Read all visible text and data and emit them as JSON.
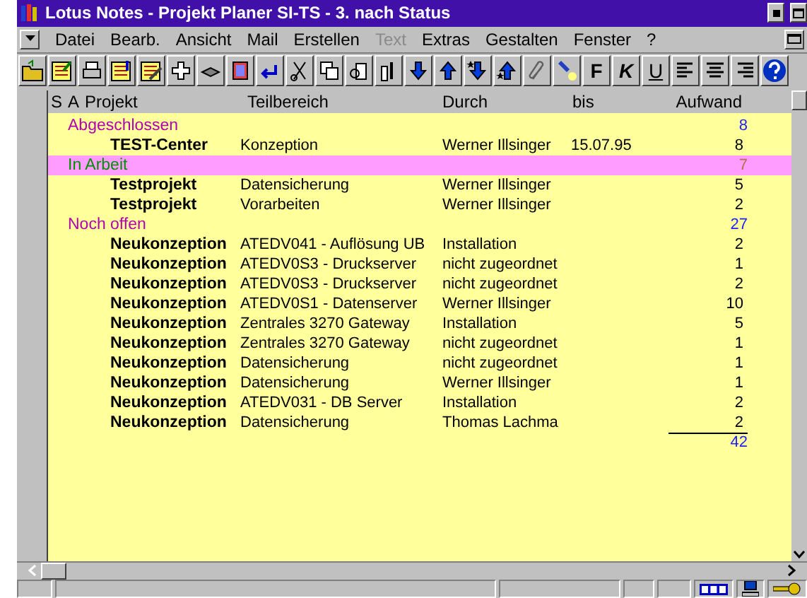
{
  "window": {
    "title": "Lotus Notes - Projekt Planer SI-TS - 3. nach Status"
  },
  "menu": [
    {
      "label": "Datei",
      "disabled": false
    },
    {
      "label": "Bearb.",
      "disabled": false
    },
    {
      "label": "Ansicht",
      "disabled": false
    },
    {
      "label": "Mail",
      "disabled": false
    },
    {
      "label": "Erstellen",
      "disabled": false
    },
    {
      "label": "Text",
      "disabled": true
    },
    {
      "label": "Extras",
      "disabled": false
    },
    {
      "label": "Gestalten",
      "disabled": false
    },
    {
      "label": "Fenster",
      "disabled": false
    },
    {
      "label": "?",
      "disabled": false
    }
  ],
  "format_buttons": [
    {
      "label": "F",
      "kind": "bold"
    },
    {
      "label": "K",
      "kind": "italic"
    },
    {
      "label": "U",
      "kind": "underline"
    }
  ],
  "columns": [
    "S",
    "A",
    "Projekt",
    "Teilbereich",
    "Durch",
    "bis",
    "Aufwand"
  ],
  "rows": [
    {
      "kind": "category",
      "label": "Abgeschlossen",
      "color": "#b000b0",
      "count": "8",
      "highlighted": false
    },
    {
      "kind": "item",
      "projekt": "TEST-Center",
      "teilbereich": "Konzeption",
      "durch": "Werner Illsinger",
      "bis": "15.07.95",
      "aufwand": "8"
    },
    {
      "kind": "category",
      "label": "In Arbeit",
      "color": "#008f00",
      "count": "7",
      "highlighted": true
    },
    {
      "kind": "item",
      "projekt": "Testprojekt",
      "teilbereich": "Datensicherung",
      "durch": "Werner Illsinger",
      "aufwand": "5"
    },
    {
      "kind": "item",
      "projekt": "Testprojekt",
      "teilbereich": "Vorarbeiten",
      "durch": "Werner Illsinger",
      "aufwand": "2"
    },
    {
      "kind": "category",
      "label": "Noch offen",
      "color": "#b000b0",
      "count": "27",
      "highlighted": false
    },
    {
      "kind": "item",
      "projekt": "Neukonzeption",
      "teilbereich": "ATEDV041 - Auflösung UB",
      "durch": "Installation",
      "aufwand": "2"
    },
    {
      "kind": "item",
      "projekt": "Neukonzeption",
      "teilbereich": "ATEDV0S3 - Druckserver",
      "durch": "nicht zugeordnet",
      "aufwand": "1"
    },
    {
      "kind": "item",
      "projekt": "Neukonzeption",
      "teilbereich": "ATEDV0S3 - Druckserver",
      "durch": "nicht zugeordnet",
      "aufwand": "2"
    },
    {
      "kind": "item",
      "projekt": "Neukonzeption",
      "teilbereich": "ATEDV0S1 - Datenserver",
      "durch": "Werner Illsinger",
      "aufwand": "10"
    },
    {
      "kind": "item",
      "projekt": "Neukonzeption",
      "teilbereich": "Zentrales 3270 Gateway",
      "durch": "Installation",
      "aufwand": "5"
    },
    {
      "kind": "item",
      "projekt": "Neukonzeption",
      "teilbereich": "Zentrales 3270 Gateway",
      "durch": "nicht zugeordnet",
      "aufwand": "1"
    },
    {
      "kind": "item",
      "projekt": "Neukonzeption",
      "teilbereich": "Datensicherung",
      "durch": "nicht zugeordnet",
      "aufwand": "1"
    },
    {
      "kind": "item",
      "projekt": "Neukonzeption",
      "teilbereich": "Datensicherung",
      "durch": "Werner Illsinger",
      "aufwand": "1"
    },
    {
      "kind": "item",
      "projekt": "Neukonzeption",
      "teilbereich": "ATEDV031 - DB Server",
      "durch": "Installation",
      "aufwand": "2"
    },
    {
      "kind": "item",
      "projekt": "Neukonzeption",
      "teilbereich": "Datensicherung",
      "durch": "Thomas Lachma",
      "aufwand": "2"
    },
    {
      "kind": "total",
      "count": "42"
    }
  ]
}
